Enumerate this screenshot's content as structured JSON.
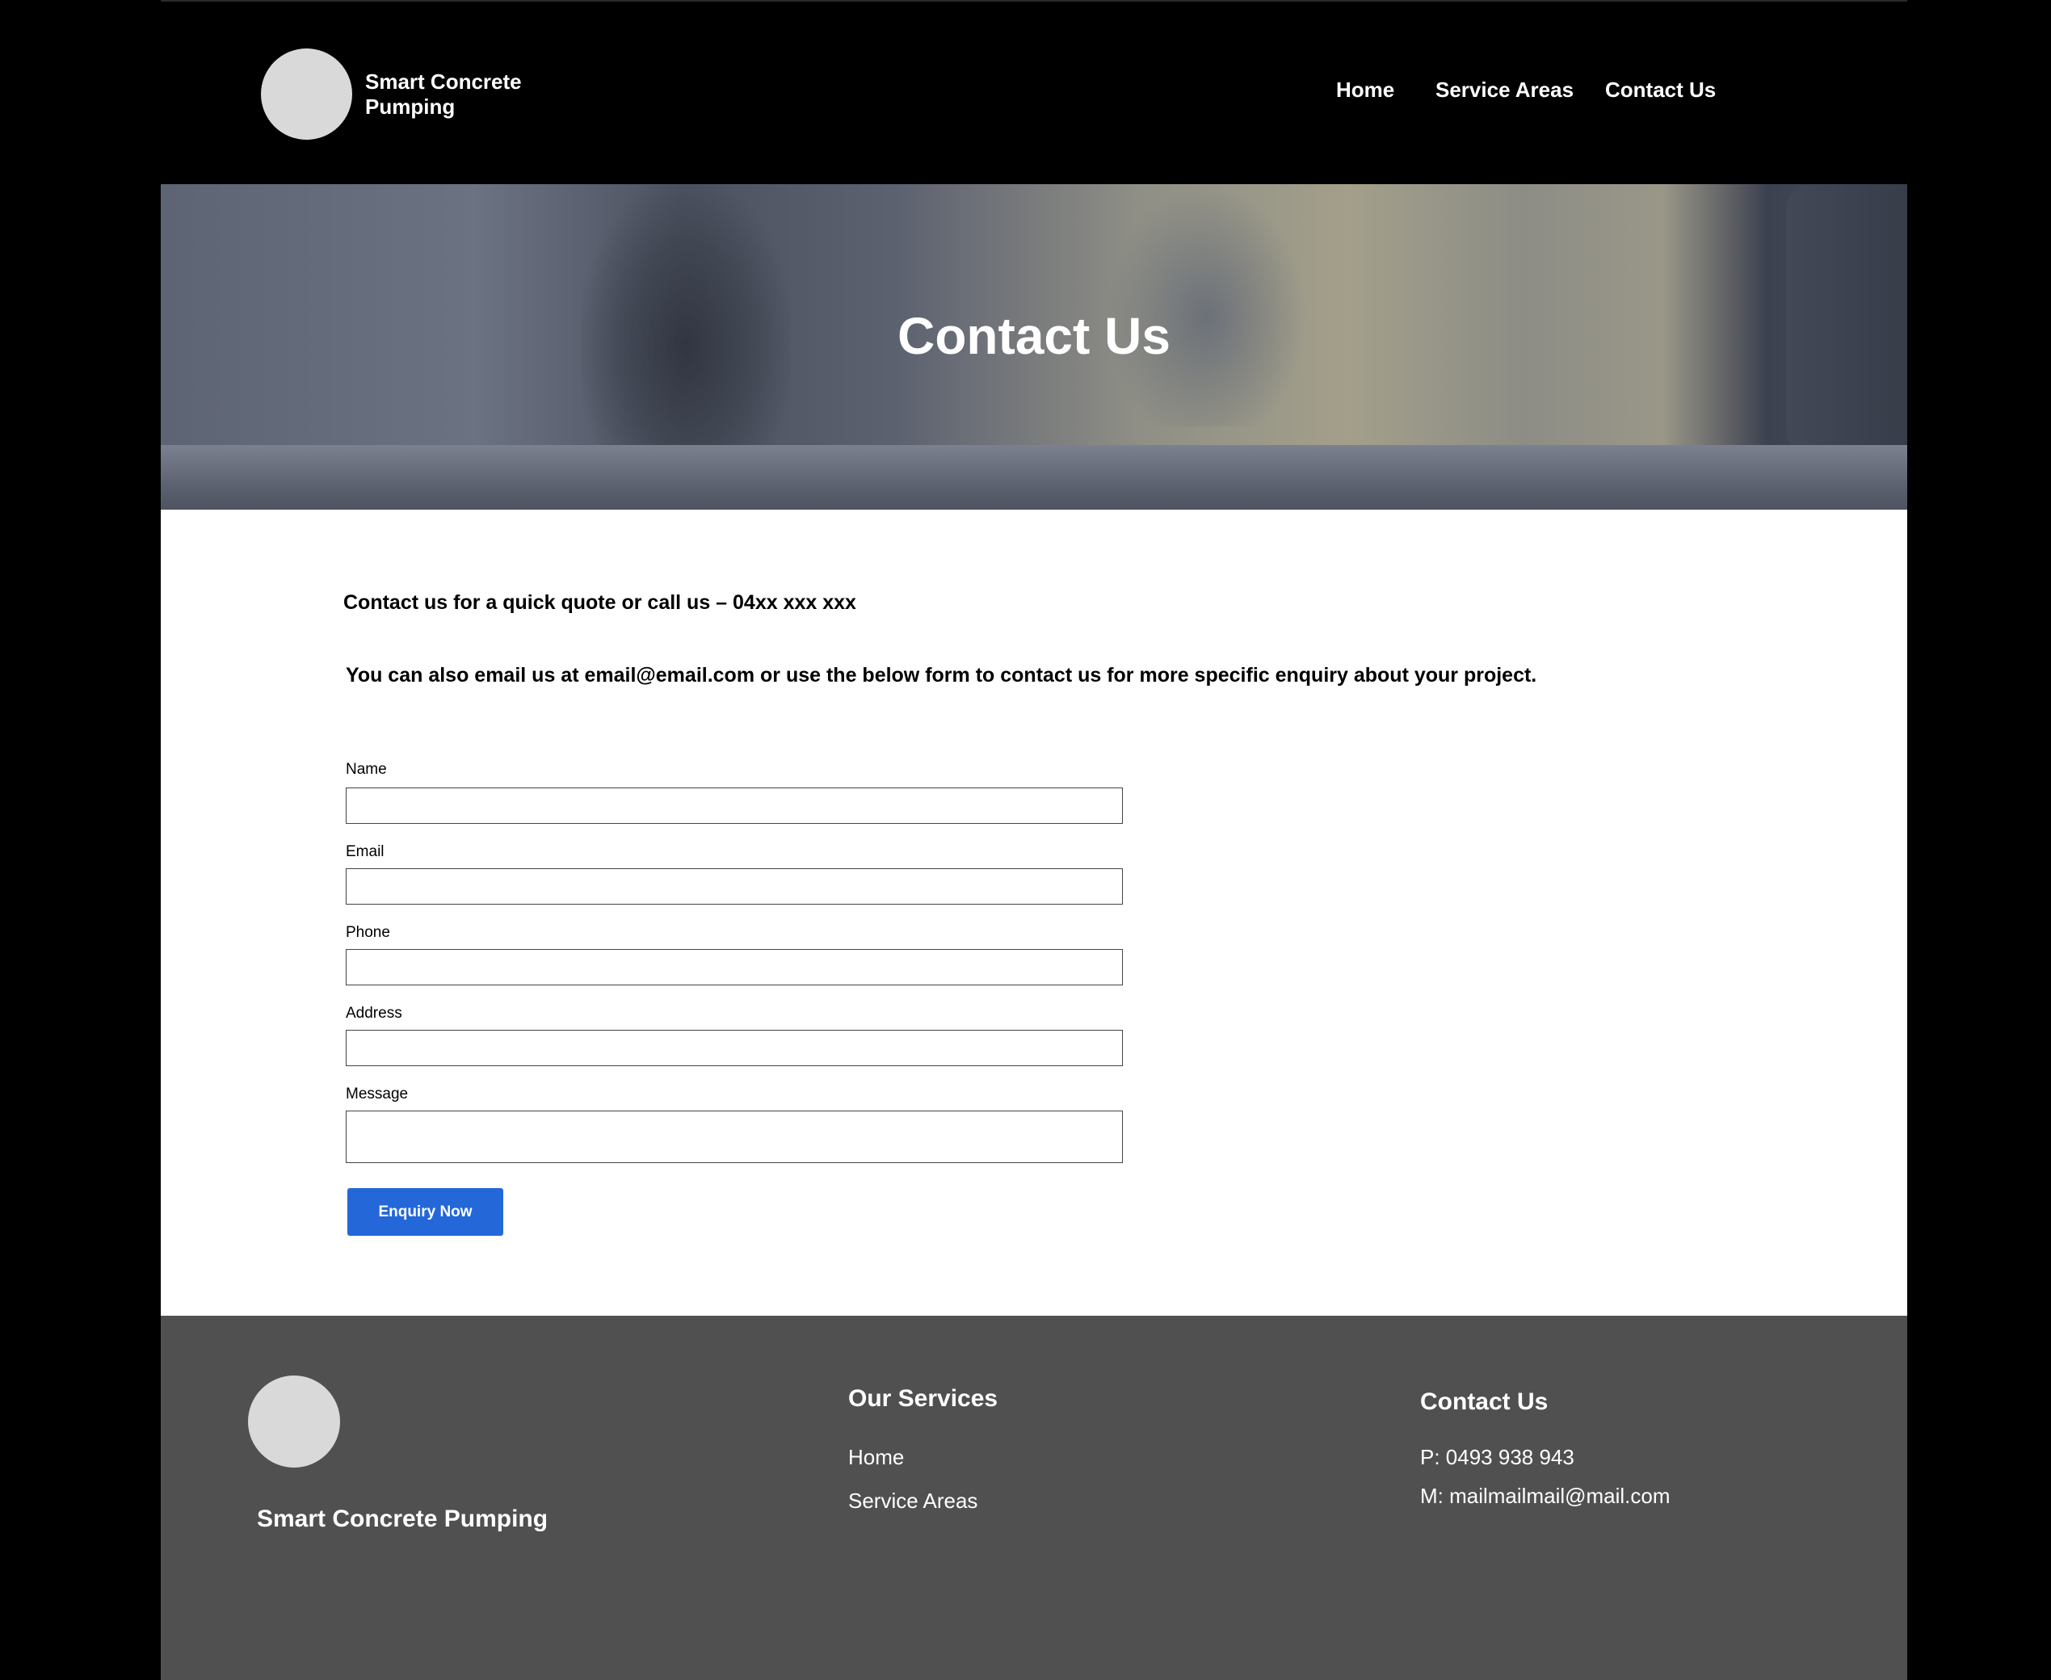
{
  "brand": {
    "name_line1": "Smart Concrete",
    "name_line2": "Pumping"
  },
  "nav": {
    "items": [
      {
        "label": "Home"
      },
      {
        "label": "Service Areas"
      },
      {
        "label": "Contact Us"
      }
    ]
  },
  "hero": {
    "title": "Contact Us"
  },
  "intro": {
    "line1": "Contact us for a quick quote or call us – 04xx xxx xxx",
    "line2": "You can also email us at email@email.com or use the below form to contact us for more specific enquiry about your project."
  },
  "form": {
    "fields": [
      {
        "label": "Name",
        "value": ""
      },
      {
        "label": "Email",
        "value": ""
      },
      {
        "label": "Phone",
        "value": ""
      },
      {
        "label": "Address",
        "value": ""
      },
      {
        "label": "Message",
        "value": ""
      }
    ],
    "submit_label": "Enquiry Now",
    "submit_color": "#2467d9"
  },
  "footer": {
    "brand": "Smart Concrete Pumping",
    "services": {
      "heading": "Our Services",
      "links": [
        {
          "label": "Home"
        },
        {
          "label": "Service Areas"
        }
      ]
    },
    "contact": {
      "heading": "Contact Us",
      "phone": "P: 0493 938 943",
      "mail": "M: mailmailmail@mail.com"
    },
    "background": "#505050"
  },
  "colors": {
    "header_bg": "#000000",
    "content_bg": "#ffffff",
    "logo_placeholder": "#d9d9d9"
  }
}
